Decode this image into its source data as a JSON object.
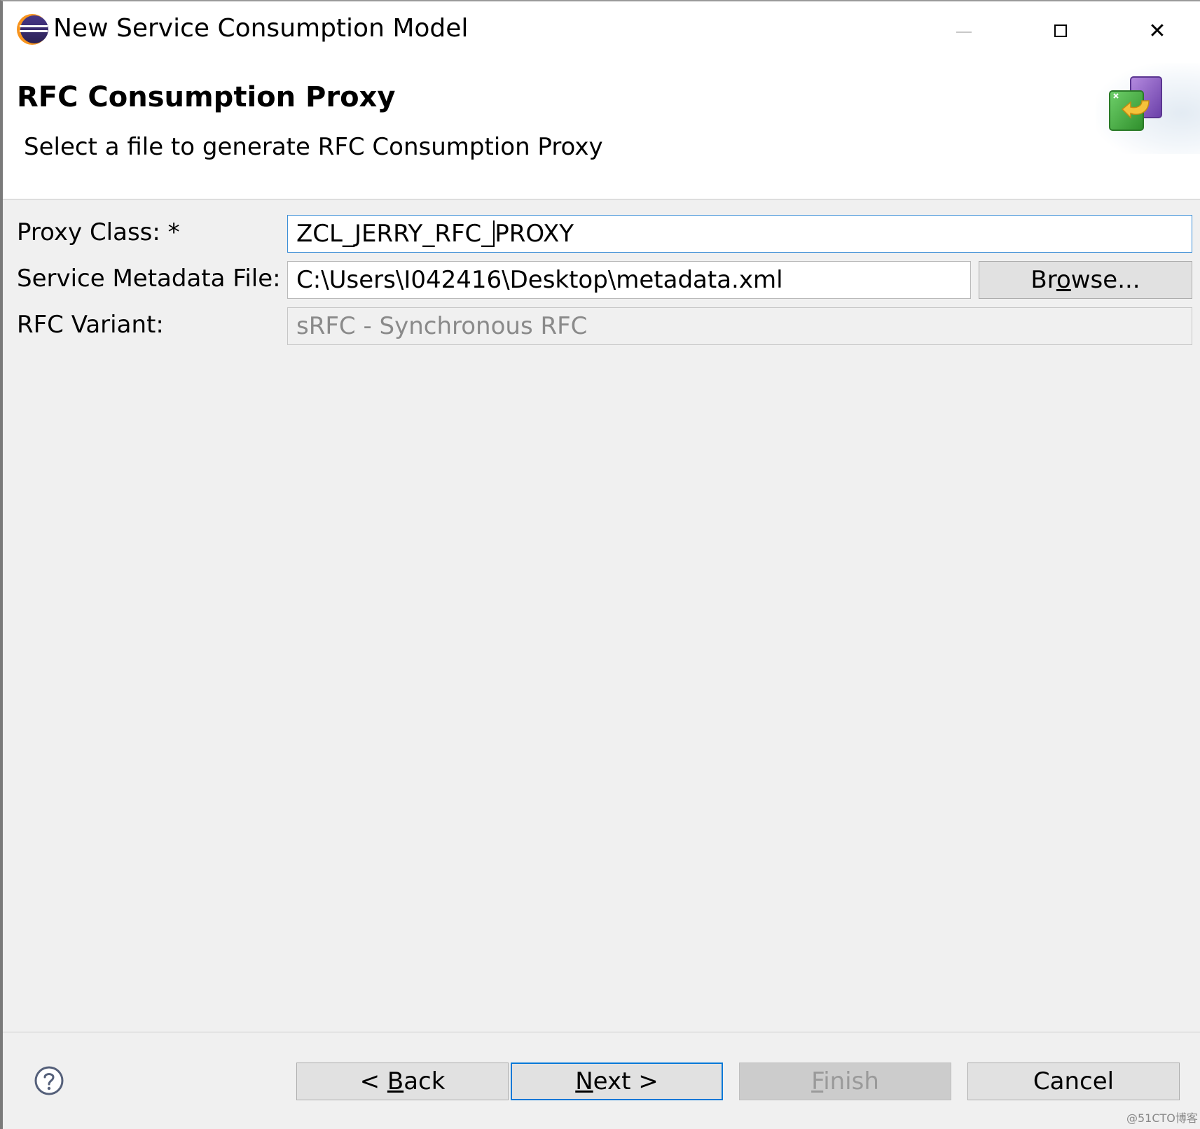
{
  "window": {
    "title": "New Service Consumption Model",
    "app_icon": "eclipse-icon",
    "controls": {
      "minimize": "minimize-icon",
      "maximize": "maximize-icon",
      "close": "close-icon",
      "close_glyph": "✕"
    }
  },
  "banner": {
    "title": "RFC Consumption Proxy",
    "description": "Select a file to generate RFC Consumption Proxy",
    "icon": "wizard-banner-icon"
  },
  "form": {
    "proxy_class": {
      "label": "Proxy Class: *",
      "value_before_caret": "ZCL_JERRY_RFC_",
      "value_after_caret": "PROXY"
    },
    "metadata_file": {
      "label": "Service Metadata File: *",
      "value": "C:\\Users\\I042416\\Desktop\\metadata.xml"
    },
    "browse": {
      "before": "Br",
      "mnemonic": "o",
      "after": "wse..."
    },
    "rfc_variant": {
      "label": "RFC Variant:",
      "value": "sRFC - Synchronous RFC"
    }
  },
  "footer": {
    "help_icon": "help-icon",
    "back": {
      "before": "< ",
      "mnemonic": "B",
      "after": "ack"
    },
    "next": {
      "before": "",
      "mnemonic": "N",
      "after": "ext >"
    },
    "finish": {
      "before": "",
      "mnemonic": "F",
      "after": "inish"
    },
    "cancel": {
      "label": "Cancel"
    }
  },
  "watermark": "@51CTO博客",
  "colors": {
    "focus_border": "#3c8fd7",
    "default_button_border": "#0078d7",
    "dialog_bg": "#f0f0f0"
  }
}
